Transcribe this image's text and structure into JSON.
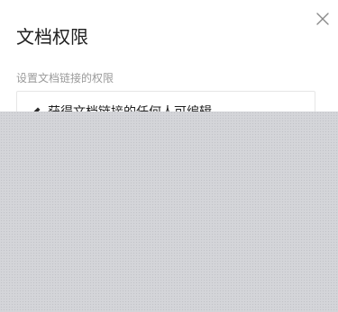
{
  "dialog": {
    "title": "文档权限",
    "subtitle": "设置文档链接的权限",
    "option": {
      "icon": "pencil-icon",
      "label": "获得文档链接的任何人可编辑"
    },
    "close_icon": "close-icon"
  },
  "colors": {
    "title": "#1f1f1f",
    "subtitle": "#9a9a9a",
    "border": "#e6e6e6",
    "overlay": "#d4d5d9"
  }
}
